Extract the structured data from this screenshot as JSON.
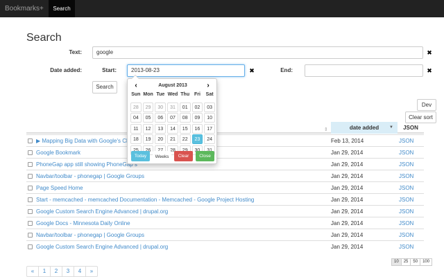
{
  "nav": {
    "brand": "Bookmarks+",
    "tab": "Search"
  },
  "page_title": "Search",
  "form": {
    "text_label": "Text:",
    "text_value": "google",
    "date_label": "Date added:",
    "start_label": "Start:",
    "start_value": "2013-08-23",
    "end_label": "End:",
    "end_value": "",
    "clear_icon": "✖",
    "search_button": "Search"
  },
  "buttons": {
    "dev": "Dev",
    "clear_sort": "Clear sort"
  },
  "table": {
    "col_date": "date added",
    "col_json": "JSON",
    "sort_icon": "⇕",
    "sort_desc_icon": "▼",
    "rows": [
      {
        "title": "▶ Mapping Big Data with Google's Cloud",
        "date": "Feb 13, 2014",
        "json": "JSON"
      },
      {
        "title": "Google Bookmark",
        "date": "Jan 29, 2014",
        "json": "JSON"
      },
      {
        "title": "PhoneGap app still showing PhoneGap s",
        "date": "Jan 29, 2014",
        "json": "JSON"
      },
      {
        "title": "Navbar/toolbar - phonegap | Google Groups",
        "date": "Jan 29, 2014",
        "json": "JSON"
      },
      {
        "title": "Page Speed Home",
        "date": "Jan 29, 2014",
        "json": "JSON"
      },
      {
        "title": "Start - memcached - memcached Documentation - Memcached - Google Project Hosting",
        "date": "Jan 29, 2014",
        "json": "JSON"
      },
      {
        "title": "Google Custom Search Engine Advanced | drupal.org",
        "date": "Jan 29, 2014",
        "json": "JSON"
      },
      {
        "title": "Google Docs - Minnesota Daily Online",
        "date": "Jan 29, 2014",
        "json": "JSON"
      },
      {
        "title": "Navbar/toolbar - phonegap | Google Groups",
        "date": "Jan 29, 2014",
        "json": "JSON"
      },
      {
        "title": "Google Custom Search Engine Advanced | drupal.org",
        "date": "Jan 29, 2014",
        "json": "JSON"
      }
    ]
  },
  "pagination": [
    "«",
    "1",
    "2",
    "3",
    "4",
    "»"
  ],
  "page_sizes": [
    "10",
    "25",
    "50",
    "100"
  ],
  "active_page_size": "10",
  "datepicker": {
    "month": "August 2013",
    "prev": "‹",
    "next": "›",
    "dow": [
      "Sun",
      "Mon",
      "Tue",
      "Wed",
      "Thu",
      "Fri",
      "Sat"
    ],
    "days": [
      [
        "28",
        "29",
        "30",
        "31",
        "01",
        "02",
        "03"
      ],
      [
        "04",
        "05",
        "06",
        "07",
        "08",
        "09",
        "10"
      ],
      [
        "11",
        "12",
        "13",
        "14",
        "15",
        "16",
        "17"
      ],
      [
        "18",
        "19",
        "20",
        "21",
        "22",
        "23",
        "24"
      ],
      [
        "25",
        "26",
        "27",
        "28",
        "29",
        "30",
        "31"
      ]
    ],
    "old_days": [
      "28",
      "29",
      "30",
      "31"
    ],
    "selected": "23",
    "buttons": {
      "today": "Today",
      "weeks": "Weeks",
      "clear": "Clear",
      "close": "Close"
    }
  },
  "colors": {
    "nav_bg": "#222222",
    "link": "#428bca",
    "selected_day": "#5bc0de",
    "clear": "#d9534f",
    "close": "#5cb85c",
    "sorted_header": "#d9edf7"
  }
}
